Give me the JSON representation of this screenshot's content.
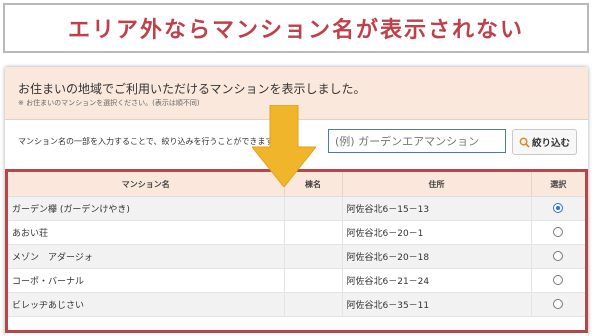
{
  "banner": {
    "title": "エリア外ならマンション名が表示されない"
  },
  "header": {
    "title": "お住まいの地域でご利用いただけるマンションを表示しました。",
    "note": "※ お住まいのマンションを選択ください。(表示は順不同)"
  },
  "search": {
    "description": "マンション名の一部を入力することで、絞り込みを行うことができます。",
    "placeholder": "(例) ガーデンエアマンション",
    "button_label": "絞り込む",
    "button_icon": "search-icon"
  },
  "colors": {
    "accent": "#c0404a",
    "frame": "#b5474b",
    "arrow": "#f0b52a",
    "header_bg": "#fbe8dc"
  },
  "table": {
    "headers": {
      "name": "マンション名",
      "building": "棟名",
      "address": "住所",
      "select": "選択"
    },
    "rows": [
      {
        "name": "ガーデン欅 (ガーデンけやき)",
        "building": "",
        "address": "阿佐谷北6－15－13",
        "selected": true
      },
      {
        "name": "あおい荘",
        "building": "",
        "address": "阿佐谷北6－20－1",
        "selected": false
      },
      {
        "name": "メゾン　アダージォ",
        "building": "",
        "address": "阿佐谷北6－20－18",
        "selected": false
      },
      {
        "name": "コーポ・バーナル",
        "building": "",
        "address": "阿佐谷北6－21－24",
        "selected": false
      },
      {
        "name": "ビレッヂあじさい",
        "building": "",
        "address": "阿佐谷北6－35－11",
        "selected": false
      }
    ]
  }
}
